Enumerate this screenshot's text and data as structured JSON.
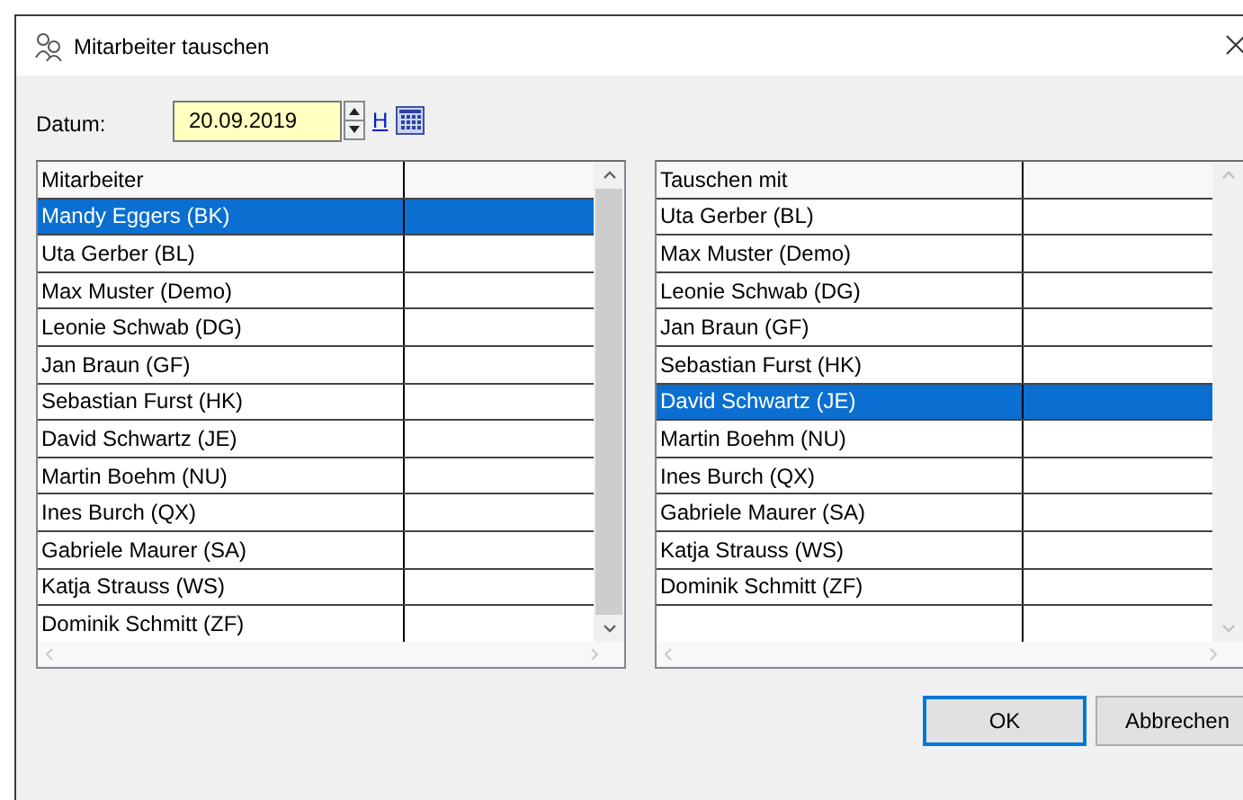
{
  "window": {
    "title": "Mitarbeiter tauschen"
  },
  "date": {
    "label": "Datum:",
    "value": "20.09.2019",
    "link": "H"
  },
  "lists": [
    {
      "header": "Mitarbeiter",
      "scrollable": true,
      "rows": [
        {
          "name": "Mandy Eggers (BK)",
          "selected": true
        },
        {
          "name": "Uta Gerber (BL)",
          "selected": false
        },
        {
          "name": "Max Muster (Demo)",
          "selected": false
        },
        {
          "name": "Leonie Schwab (DG)",
          "selected": false
        },
        {
          "name": "Jan Braun (GF)",
          "selected": false
        },
        {
          "name": "Sebastian Furst (HK)",
          "selected": false
        },
        {
          "name": "David Schwartz (JE)",
          "selected": false
        },
        {
          "name": "Martin Boehm (NU)",
          "selected": false
        },
        {
          "name": "Ines Burch (QX)",
          "selected": false
        },
        {
          "name": "Gabriele Maurer (SA)",
          "selected": false
        },
        {
          "name": "Katja Strauss (WS)",
          "selected": false
        },
        {
          "name": "Dominik Schmitt (ZF)",
          "selected": false
        }
      ]
    },
    {
      "header": "Tauschen mit",
      "scrollable": false,
      "rows": [
        {
          "name": "Uta Gerber (BL)",
          "selected": false
        },
        {
          "name": "Max Muster (Demo)",
          "selected": false
        },
        {
          "name": "Leonie Schwab (DG)",
          "selected": false
        },
        {
          "name": "Jan Braun (GF)",
          "selected": false
        },
        {
          "name": "Sebastian Furst (HK)",
          "selected": false
        },
        {
          "name": "David Schwartz (JE)",
          "selected": true
        },
        {
          "name": "Martin Boehm (NU)",
          "selected": false
        },
        {
          "name": "Ines Burch (QX)",
          "selected": false
        },
        {
          "name": "Gabriele Maurer (SA)",
          "selected": false
        },
        {
          "name": "Katja Strauss (WS)",
          "selected": false
        },
        {
          "name": "Dominik Schmitt (ZF)",
          "selected": false
        }
      ]
    }
  ],
  "buttons": [
    {
      "label": "OK",
      "default": true
    },
    {
      "label": "Abbrechen",
      "default": false
    }
  ]
}
